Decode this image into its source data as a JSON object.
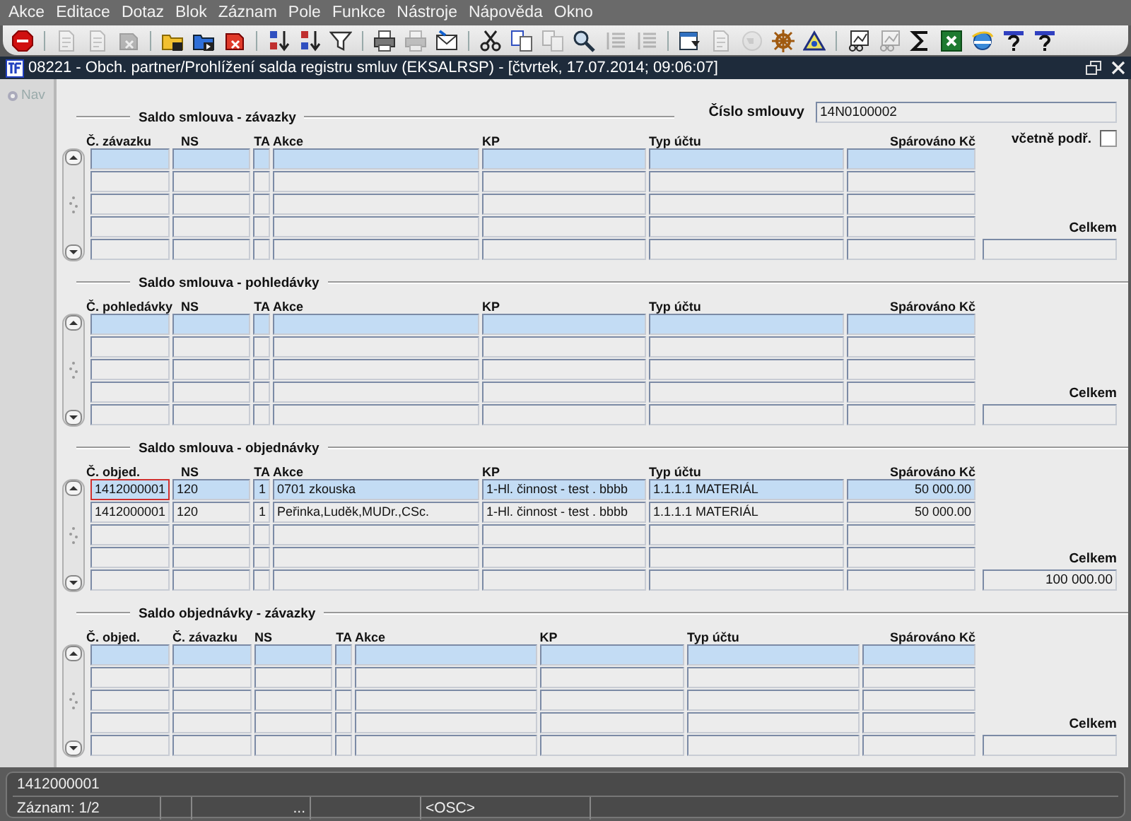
{
  "menu": [
    "Akce",
    "Editace",
    "Dotaz",
    "Blok",
    "Záznam",
    "Pole",
    "Funkce",
    "Nástroje",
    "Nápověda",
    "Okno"
  ],
  "toolbar": [
    [
      {
        "kind": "exit",
        "disabled": false
      }
    ],
    [
      {
        "kind": "page",
        "disabled": true
      },
      {
        "kind": "page",
        "disabled": true
      },
      {
        "kind": "delete",
        "disabled": true
      }
    ],
    [
      {
        "kind": "folder",
        "disabled": false
      },
      {
        "kind": "save",
        "disabled": false
      },
      {
        "kind": "delete",
        "disabled": false
      }
    ],
    [
      {
        "kind": "sort-az",
        "disabled": false
      },
      {
        "kind": "sort-za",
        "disabled": false
      },
      {
        "kind": "filter",
        "disabled": false
      }
    ],
    [
      {
        "kind": "printer",
        "disabled": false
      },
      {
        "kind": "printer",
        "disabled": true
      },
      {
        "kind": "mail",
        "disabled": false
      }
    ],
    [
      {
        "kind": "scissors",
        "disabled": false
      },
      {
        "kind": "copy",
        "disabled": false
      },
      {
        "kind": "copy",
        "disabled": true
      },
      {
        "kind": "search",
        "disabled": false
      },
      {
        "kind": "list",
        "disabled": true
      },
      {
        "kind": "list",
        "disabled": true
      }
    ],
    [
      {
        "kind": "calendar",
        "disabled": false
      },
      {
        "kind": "page",
        "disabled": true
      },
      {
        "kind": "globe",
        "disabled": true
      },
      {
        "kind": "wheel",
        "disabled": false
      },
      {
        "kind": "triangle",
        "disabled": false
      }
    ],
    [
      {
        "kind": "chart",
        "disabled": false
      },
      {
        "kind": "chart",
        "disabled": true
      },
      {
        "kind": "sigma",
        "disabled": false
      },
      {
        "kind": "sheet",
        "disabled": false
      },
      {
        "kind": "browser",
        "disabled": false
      },
      {
        "kind": "help",
        "disabled": false
      },
      {
        "kind": "help",
        "disabled": false
      }
    ]
  ],
  "window": {
    "title": "08221 - Obch. partner/Prohlížení salda registru smluv (EKSALRSP) - [čtvrtek, 17.07.2014; 09:06:07]"
  },
  "nav": {
    "label": "Nav"
  },
  "contract": {
    "label": "Číslo smlouvy",
    "value": "14N0100002"
  },
  "include_sub": {
    "label": "včetně podř.",
    "checked": false
  },
  "blocks": [
    {
      "title": "Saldo smlouva - závazky",
      "columns": [
        {
          "label": "Č. závazku",
          "kind": "id"
        },
        {
          "label": "NS",
          "kind": "ns"
        },
        {
          "label": "TA",
          "kind": "ta"
        },
        {
          "label": "Akce",
          "kind": "akce"
        },
        {
          "label": "KP",
          "kind": "kp"
        },
        {
          "label": "Typ účtu",
          "kind": "typ"
        },
        {
          "label": "Spárováno Kč",
          "kind": "amount"
        }
      ],
      "rows": [
        {
          "selected": true
        },
        {
          "selected": false
        },
        {
          "selected": false
        },
        {
          "selected": false
        },
        {
          "selected": false
        }
      ],
      "total": {
        "label": "Celkem"
      }
    },
    {
      "title": "Saldo smlouva - pohledávky",
      "columns": [
        {
          "label": "Č. pohledávky",
          "kind": "id"
        },
        {
          "label": "NS",
          "kind": "ns"
        },
        {
          "label": "TA",
          "kind": "ta"
        },
        {
          "label": "Akce",
          "kind": "akce"
        },
        {
          "label": "KP",
          "kind": "kp"
        },
        {
          "label": "Typ účtu",
          "kind": "typ"
        },
        {
          "label": "Spárováno Kč",
          "kind": "amount"
        }
      ],
      "rows": [
        {
          "selected": true
        },
        {
          "selected": false
        },
        {
          "selected": false
        },
        {
          "selected": false
        },
        {
          "selected": false
        }
      ],
      "total": {
        "label": "Celkem"
      }
    },
    {
      "title": "Saldo smlouva - objednávky",
      "columns": [
        {
          "label": "Č. objed.",
          "kind": "id"
        },
        {
          "label": "NS",
          "kind": "ns"
        },
        {
          "label": "TA",
          "kind": "ta"
        },
        {
          "label": "Akce",
          "kind": "akce"
        },
        {
          "label": "KP",
          "kind": "kp"
        },
        {
          "label": "Typ účtu",
          "kind": "typ"
        },
        {
          "label": "Spárováno Kč",
          "kind": "amount"
        }
      ],
      "rows": [
        {
          "selected": true,
          "cells": [
            {
              "text": "1412000001",
              "focused": true
            },
            {
              "text": "120",
              "focused": false
            },
            {
              "text": "1",
              "focused": false
            },
            {
              "text": "0701 zkouska",
              "focused": false
            },
            {
              "text": "1-Hl. činnost - test . bbbb",
              "focused": false
            },
            {
              "text": "1.1.1.1 MATERIÁL",
              "focused": false
            },
            {
              "text": "50 000.00",
              "focused": false
            }
          ]
        },
        {
          "selected": false,
          "cells": [
            {
              "text": "1412000001",
              "focused": false
            },
            {
              "text": "120",
              "focused": false
            },
            {
              "text": "1",
              "focused": false
            },
            {
              "text": "Peřinka,Luděk,MUDr.,CSc.",
              "focused": false
            },
            {
              "text": "1-Hl. činnost - test . bbbb",
              "focused": false
            },
            {
              "text": "1.1.1.1 MATERIÁL",
              "focused": false
            },
            {
              "text": "50 000.00",
              "focused": false
            }
          ]
        },
        {
          "selected": false
        },
        {
          "selected": false
        },
        {
          "selected": false
        }
      ],
      "total": {
        "label": "Celkem",
        "value": "100 000.00"
      }
    },
    {
      "title": "Saldo objednávky - závazky",
      "columns": [
        {
          "label": "Č. objed.",
          "kind": "id"
        },
        {
          "label": "Č. závazku",
          "kind": "id"
        },
        {
          "label": "NS",
          "kind": "ns"
        },
        {
          "label": "TA",
          "kind": "ta"
        },
        {
          "label": "Akce",
          "kind": "akce"
        },
        {
          "label": "KP",
          "kind": "kp"
        },
        {
          "label": "Typ účtu",
          "kind": "typ"
        },
        {
          "label": "Spárováno Kč",
          "kind": "amount"
        }
      ],
      "rows": [
        {
          "selected": true
        },
        {
          "selected": false
        },
        {
          "selected": false
        },
        {
          "selected": false
        },
        {
          "selected": false
        }
      ],
      "total": {
        "label": "Celkem"
      }
    }
  ],
  "status": {
    "message": "1412000001",
    "segments": [
      "Záznam: 1/2",
      "...",
      "<OSC>"
    ]
  }
}
